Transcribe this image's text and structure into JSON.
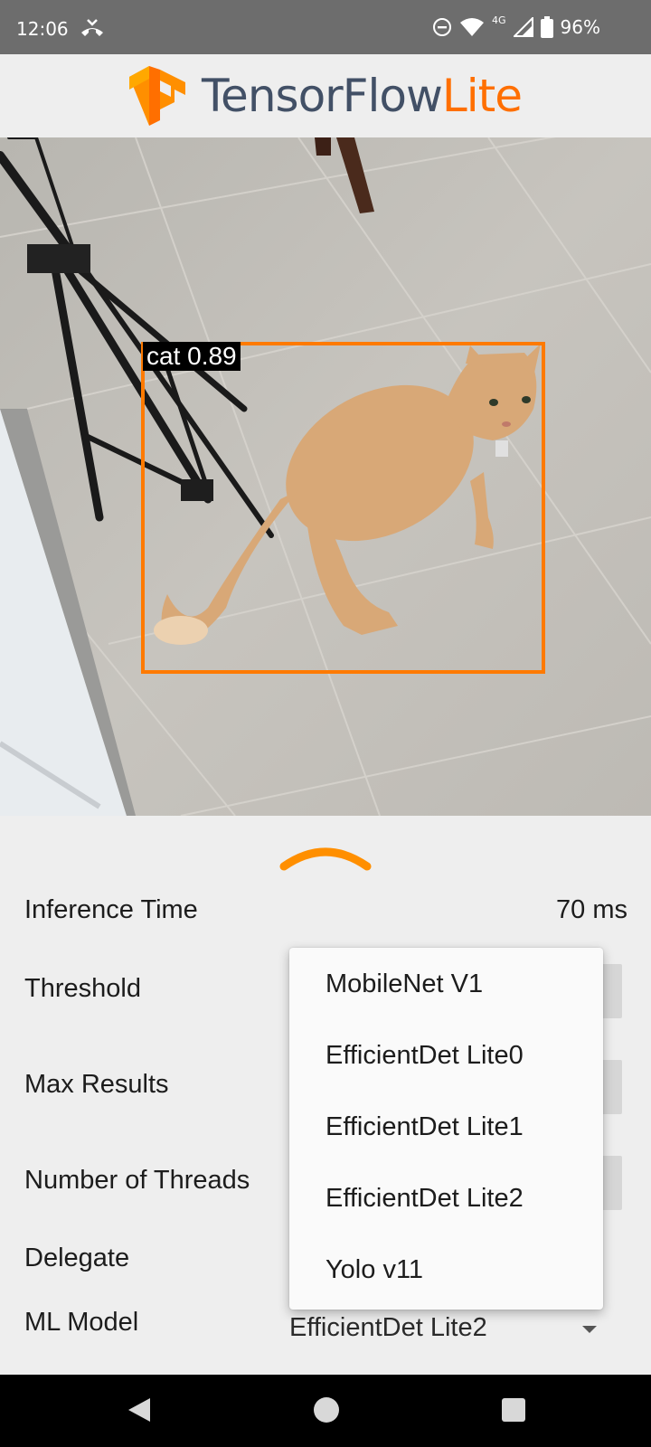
{
  "status_bar": {
    "time": "12:06",
    "network": "4G",
    "battery": "96%"
  },
  "header": {
    "logo_text_main": "TensorFlow",
    "logo_text_accent": "Lite",
    "brand_orange": "#ff6f00",
    "brand_slate": "#425066"
  },
  "detection": {
    "label": "cat 0.89",
    "box_color": "#ff7a00"
  },
  "settings": {
    "inference_time_label": "Inference Time",
    "inference_time_value": "70 ms",
    "threshold_label": "Threshold",
    "max_results_label": "Max Results",
    "threads_label": "Number of Threads",
    "delegate_label": "Delegate",
    "ml_model_label": "ML Model",
    "ml_model_selected": "EfficientDet Lite2"
  },
  "dropdown": {
    "options": [
      "MobileNet V1",
      "EfficientDet Lite0",
      "EfficientDet Lite1",
      "EfficientDet Lite2",
      "Yolo v11"
    ]
  },
  "icons": {
    "status": [
      "missed-call-icon",
      "dnd-icon",
      "wifi-icon",
      "signal-icon",
      "battery-icon"
    ],
    "navigation": [
      "back-icon",
      "home-icon",
      "recents-icon"
    ],
    "sheet": "chevron-up-icon"
  }
}
